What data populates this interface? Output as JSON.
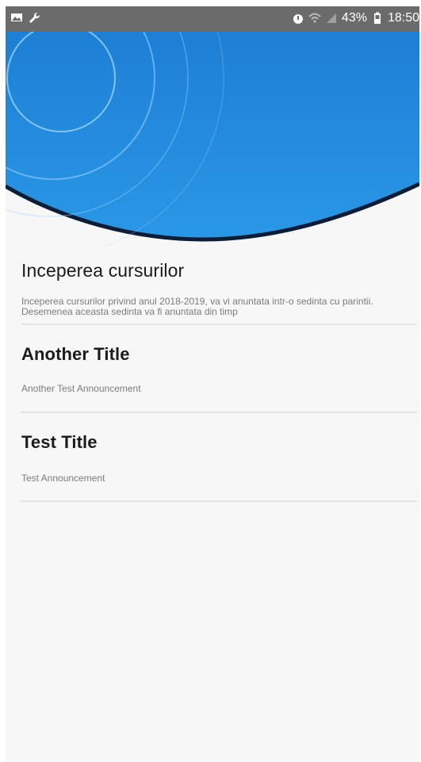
{
  "status_bar": {
    "left_icons": [
      "image-icon",
      "wrench-icon"
    ],
    "right_icons": [
      "alarm-icon",
      "wifi-icon",
      "signal-icon"
    ],
    "battery": "43%",
    "time": "18:50"
  },
  "colors": {
    "status_bar": "#6b6b6b",
    "header_blue_light": "#3ba7e8",
    "header_blue_dark": "#1565c0",
    "divider": "#e4e4e4",
    "background": "#f7f7f7"
  },
  "announcements": [
    {
      "title": "Inceperea cursurilor",
      "body": "Inceperea cursurilor privind anul 2018-2019, va vi anuntata intr-o sedinta cu parintii. Desemenea aceasta sedinta va fi anuntata din timp"
    },
    {
      "title": "Another Title",
      "body": "Another Test Announcement"
    },
    {
      "title": "Test Title",
      "body": "Test Announcement"
    }
  ]
}
